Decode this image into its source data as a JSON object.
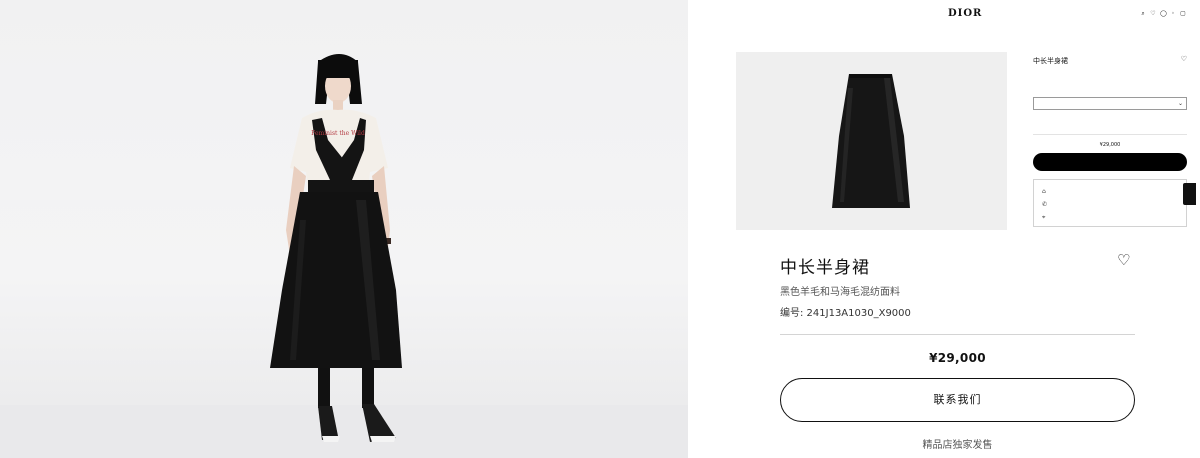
{
  "photo": {
    "alt_subject": "model-wearing-skirt",
    "tshirt_print": "Feminist the Wild"
  },
  "header": {
    "links": [
      "",
      ""
    ],
    "logo": "DIOR",
    "icons": [
      "search-icon",
      "heart-icon",
      "chat-icon",
      "account-icon",
      "bag-icon"
    ]
  },
  "nav": {
    "items": [
      "",
      "",
      "",
      "",
      "",
      "",
      "",
      "",
      "",
      "",
      ""
    ]
  },
  "side_panel": {
    "title": "中长半身裙",
    "subtitle": "",
    "reference": "",
    "size_select": "",
    "size_guide": "",
    "price": "¥29,000",
    "buy_label": "",
    "services": [
      {
        "icon": "store-icon",
        "label": ""
      },
      {
        "icon": "phone-icon",
        "label": ""
      },
      {
        "icon": "location-icon",
        "label": ""
      }
    ],
    "tab_label": ""
  },
  "product": {
    "title": "中长半身裙",
    "description": "黑色羊毛和马海毛混纺面料",
    "reference": "编号: 241J13A1030_X9000",
    "price": "¥29,000",
    "contact_label": "联系我们",
    "store_label": "精品店独家发售"
  },
  "colors": {
    "accent": "#000000",
    "background": "#ffffff",
    "panel": "#efefef"
  }
}
